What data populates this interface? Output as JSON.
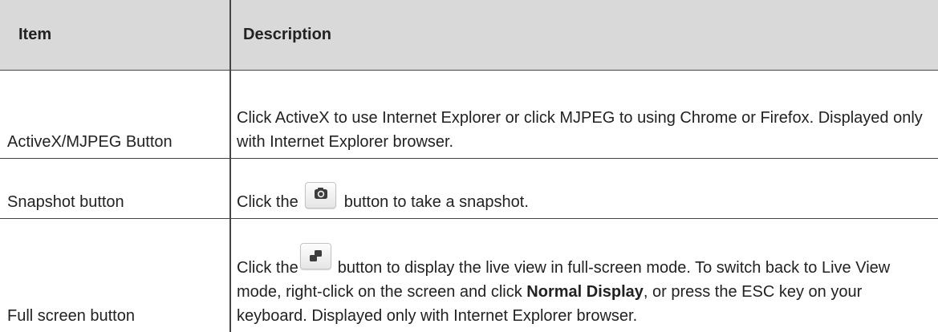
{
  "table": {
    "headers": {
      "item": "Item",
      "description": "Description"
    },
    "rows": [
      {
        "item": "ActiveX/MJPEG Button",
        "description": "Click ActiveX to use Internet Explorer or click MJPEG to using Chrome or Firefox. Displayed only with Internet Explorer browser."
      },
      {
        "item": "Snapshot button",
        "description_before": "Click the",
        "description_icon": "camera-icon",
        "description_after": "button to take a snapshot."
      },
      {
        "item": "Full screen button",
        "description_before": "Click the",
        "description_icon": "fullscreen-icon",
        "description_mid": "button to display the live view in full-screen mode. To switch back to Live View mode, right-click on the screen and click",
        "description_bold": "Normal Display",
        "description_after": ", or press the ESC key on your keyboard. Displayed only with Internet Explorer browser."
      }
    ]
  }
}
